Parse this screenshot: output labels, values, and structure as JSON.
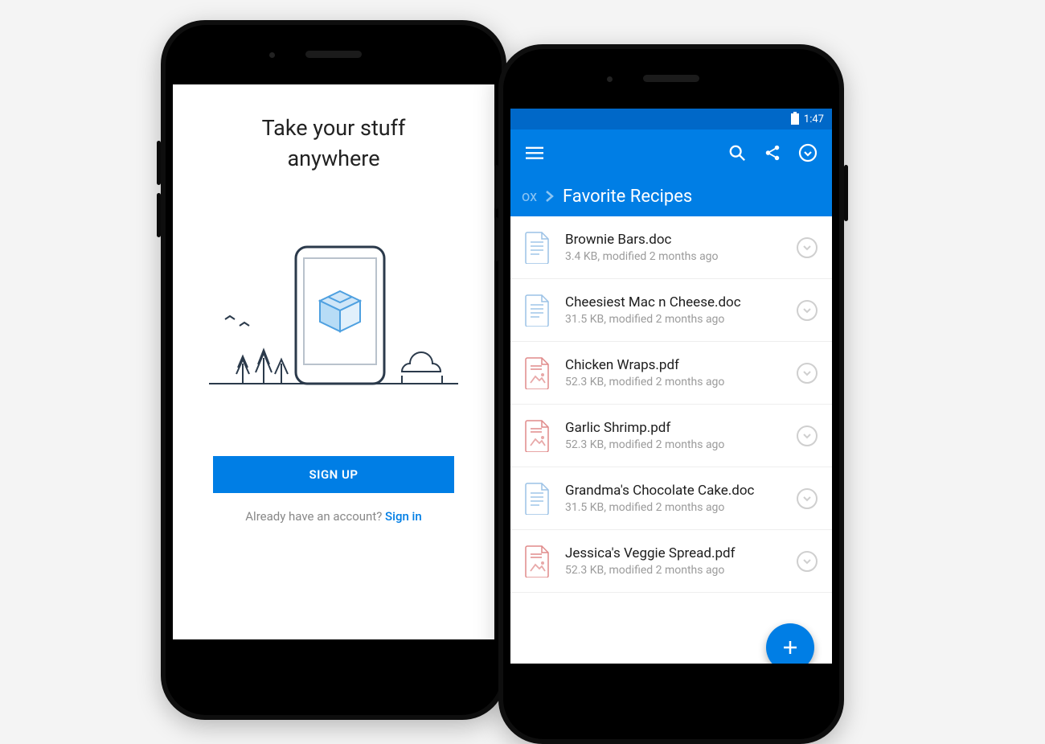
{
  "left": {
    "headline_line1": "Take your stuff",
    "headline_line2": "anywhere",
    "signup_label": "SIGN UP",
    "already_text": "Already have an account? ",
    "signin_label": "Sign in"
  },
  "right": {
    "statusbar": {
      "time": "1:47"
    },
    "breadcrumb": {
      "previous_fragment": "ox",
      "current": "Favorite Recipes"
    },
    "files": [
      {
        "name": "Brownie Bars.doc",
        "meta": "3.4 KB, modified 2 months ago",
        "kind": "doc"
      },
      {
        "name": "Cheesiest Mac n Cheese.doc",
        "meta": "31.5 KB, modified 2 months ago",
        "kind": "doc"
      },
      {
        "name": "Chicken Wraps.pdf",
        "meta": "52.3 KB, modified 2 months ago",
        "kind": "pdf"
      },
      {
        "name": "Garlic Shrimp.pdf",
        "meta": "52.3 KB, modified 2 months ago",
        "kind": "pdf"
      },
      {
        "name": "Grandma's Chocolate Cake.doc",
        "meta": "31.5 KB, modified 2 months ago",
        "kind": "doc"
      },
      {
        "name": "Jessica's Veggie Spread.pdf",
        "meta": "52.3 KB, modified 2 months ago",
        "kind": "pdf"
      }
    ]
  },
  "colors": {
    "brand": "#007ee5",
    "brand_dark": "#0068c8"
  }
}
